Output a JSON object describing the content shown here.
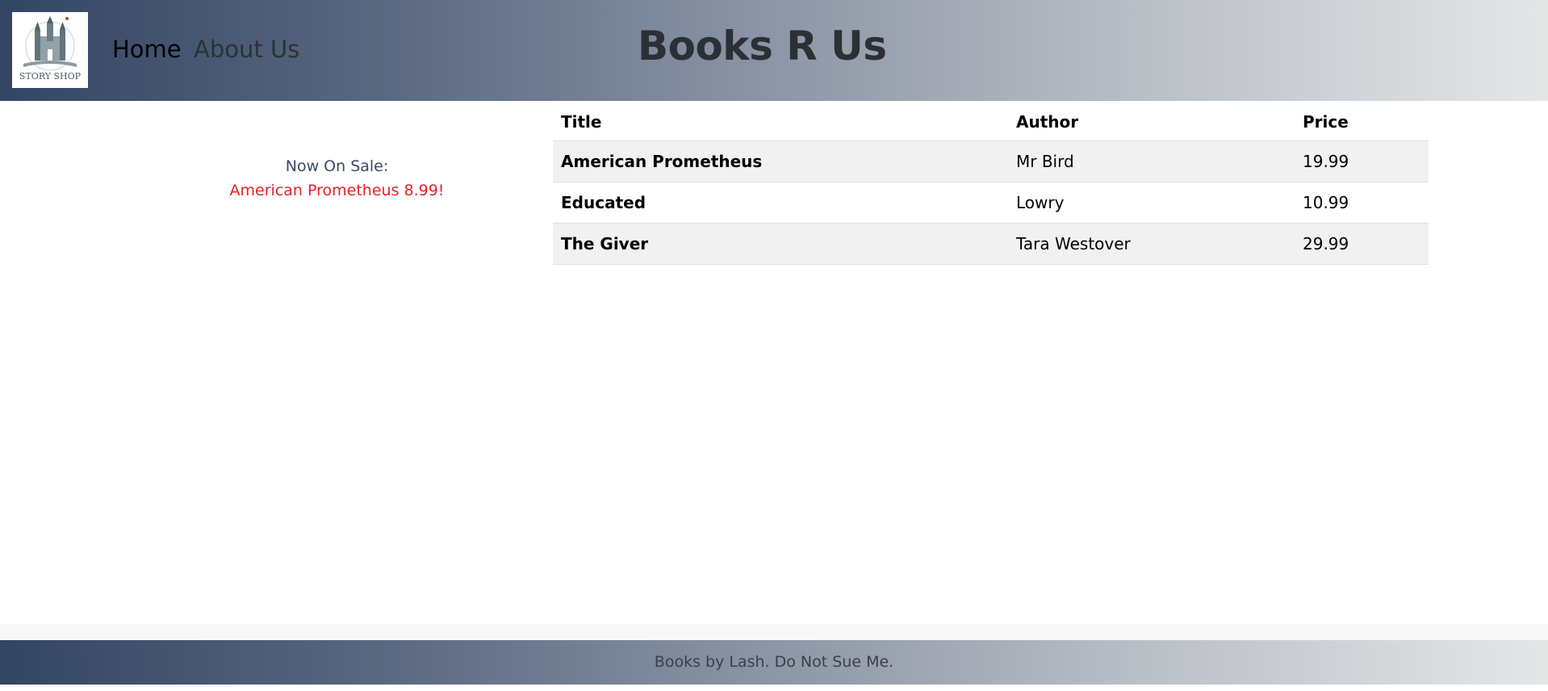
{
  "header": {
    "logo_text": "STORY SHOP",
    "nav": {
      "home": "Home",
      "about": "About Us"
    },
    "title": "Books R Us"
  },
  "sale": {
    "label": "Now On Sale:",
    "item": "American Prometheus 8.99!"
  },
  "table": {
    "columns": [
      "Title",
      "Author",
      "Price"
    ],
    "rows": [
      {
        "title": "American Prometheus",
        "author": "Mr Bird",
        "price": "19.99"
      },
      {
        "title": "Educated",
        "author": "Lowry",
        "price": "10.99"
      },
      {
        "title": "The Giver",
        "author": "Tara Westover",
        "price": "29.99"
      }
    ]
  },
  "footer": {
    "text": "Books by Lash. Do Not Sue Me."
  },
  "colors": {
    "header_gradient_start": "#334563",
    "header_gradient_end": "#e5e6e7",
    "sale_item": "#e8202a",
    "row_stripe": "#f1f1f1"
  }
}
